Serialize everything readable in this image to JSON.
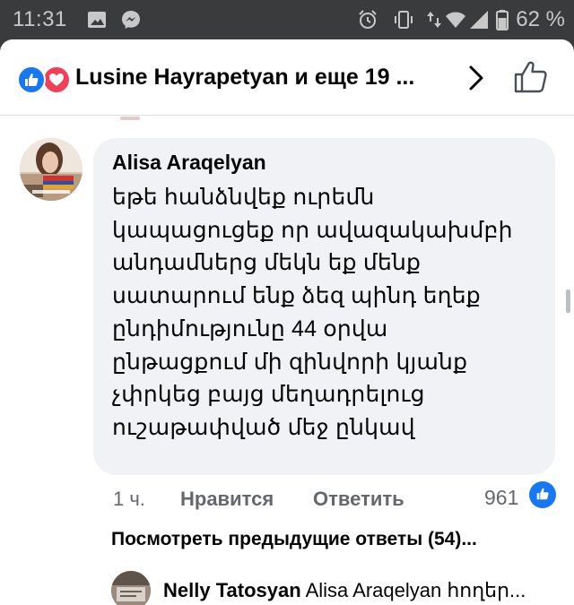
{
  "status_bar": {
    "time": "11:31",
    "battery": "62 %",
    "left_icons": [
      "gallery-icon",
      "messenger-icon"
    ],
    "right_icons": [
      "alarm-icon",
      "vibrate-icon",
      "data-arrows-icon",
      "wifi-icon",
      "signal-icon",
      "battery-icon"
    ]
  },
  "header": {
    "reactions": [
      "like",
      "love"
    ],
    "reactors_text": "Lusine Hayrapetyan и еще 19 ..."
  },
  "comment": {
    "author": "Alisa Araqelyan",
    "text_lines": [
      "եթե հանձնվեք ուրեմն",
      "կապացուցեք որ ավազակախմբի",
      "անդամներց մեկն եք մենք",
      "սատարում ենք ձեզ պինդ եղեք",
      "ընդիմությունը 44 օրվա",
      "ընթացքում մի զինվորի կյանք",
      "չփրկեց բայց մեղադրելուց",
      "ուշաթափված մեջ ընկավ"
    ],
    "time": "1 ч.",
    "like_label": "Нравится",
    "reply_label": "Ответить",
    "like_count": "961"
  },
  "replies": {
    "view_previous": "Посмотреть предыдущие ответы (54)...",
    "latest": {
      "author": "Nelly Tatosyan",
      "preview": "Alisa Araqelyan հողեր..."
    }
  },
  "colors": {
    "facebook_blue": "#1877f2",
    "love_red": "#f33e58",
    "bubble_bg": "#f0f2f5",
    "meta_text": "#65676b"
  }
}
